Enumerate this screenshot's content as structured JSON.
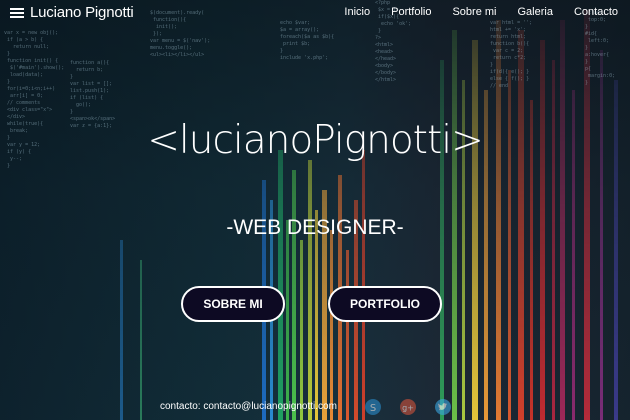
{
  "header": {
    "brand": "Luciano Pignotti",
    "nav": [
      "Inicio",
      "Portfolio",
      "Sobre mi",
      "Galeria",
      "Contacto"
    ]
  },
  "hero": {
    "title": "<lucianoPignotti>",
    "subtitle": "-WEB DESIGNER-"
  },
  "buttons": {
    "about": "SOBRE MI",
    "portfolio": "PORTFOLIO"
  },
  "footer": {
    "contact": "contacto: contacto@lucianopignotti.com"
  },
  "icons": {
    "menu": "menu-icon",
    "social": [
      "skype-icon",
      "google-plus-icon",
      "twitter-icon"
    ]
  },
  "colors": {
    "button_bg": "#0d0a23",
    "text": "#ffffff"
  }
}
